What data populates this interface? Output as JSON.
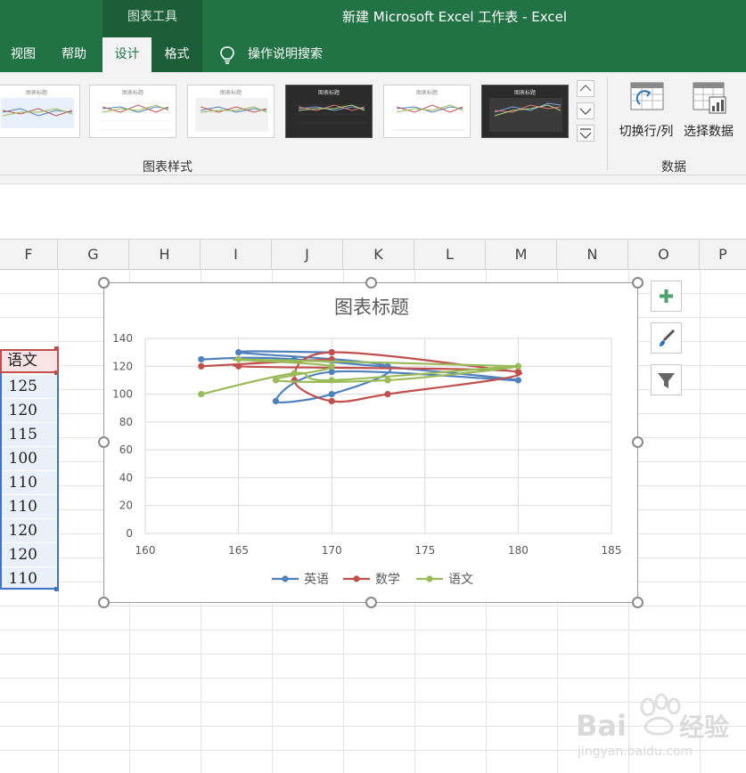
{
  "window": {
    "context_tools": "图表工具",
    "title": "新建 Microsoft Excel 工作表  -  Excel"
  },
  "tabs": [
    {
      "label": "视图"
    },
    {
      "label": "帮助"
    },
    {
      "label": "设计"
    },
    {
      "label": "格式"
    }
  ],
  "tell_me": "操作说明搜索",
  "ribbon": {
    "chart_styles_label": "图表样式",
    "data_group_label": "数据",
    "switch_row_col": "切换行/列",
    "select_data": "选择数据",
    "thumb_titles": [
      "图表标题",
      "图表标题",
      "图表标题",
      "图表标题",
      "图表标题",
      "图表标题"
    ]
  },
  "columns": [
    "F",
    "G",
    "H",
    "I",
    "J",
    "K",
    "L",
    "M",
    "N",
    "O",
    "P"
  ],
  "sheet": {
    "header": "语文",
    "values": [
      "125",
      "120",
      "115",
      "100",
      "110",
      "110",
      "120",
      "120",
      "110"
    ]
  },
  "colors": {
    "excel_green": "#217346",
    "series_blue": "#4f81bd",
    "series_red": "#c0504d",
    "series_green": "#9bbb59"
  },
  "chart_data": {
    "type": "scatter",
    "title": "图表标题",
    "xlim": [
      160,
      185
    ],
    "ylim": [
      0,
      140
    ],
    "x_ticks": [
      160,
      165,
      170,
      175,
      180,
      185
    ],
    "y_ticks": [
      0,
      20,
      40,
      60,
      80,
      100,
      120,
      140
    ],
    "grid": true,
    "legend_position": "bottom",
    "series": [
      {
        "name": "英语",
        "color": "#4f81bd",
        "points": [
          [
            163,
            125
          ],
          [
            168,
            125
          ],
          [
            180,
            110
          ],
          [
            170,
            116
          ],
          [
            167,
            95
          ],
          [
            170,
            100
          ],
          [
            173,
            120
          ],
          [
            165,
            130
          ],
          [
            170,
            130
          ]
        ]
      },
      {
        "name": "数学",
        "color": "#c0504d",
        "points": [
          [
            163,
            120
          ],
          [
            170,
            125
          ],
          [
            165,
            120
          ],
          [
            180,
            116
          ],
          [
            173,
            100
          ],
          [
            170,
            95
          ],
          [
            168,
            110
          ],
          [
            170,
            130
          ],
          [
            180,
            116
          ]
        ]
      },
      {
        "name": "语文",
        "color": "#9bbb59",
        "points": [
          [
            163,
            100
          ],
          [
            168,
            115
          ],
          [
            170,
            110
          ],
          [
            180,
            120
          ],
          [
            173,
            110
          ],
          [
            167,
            110
          ],
          [
            170,
            120
          ],
          [
            165,
            125
          ],
          [
            180,
            120
          ]
        ]
      }
    ]
  }
}
